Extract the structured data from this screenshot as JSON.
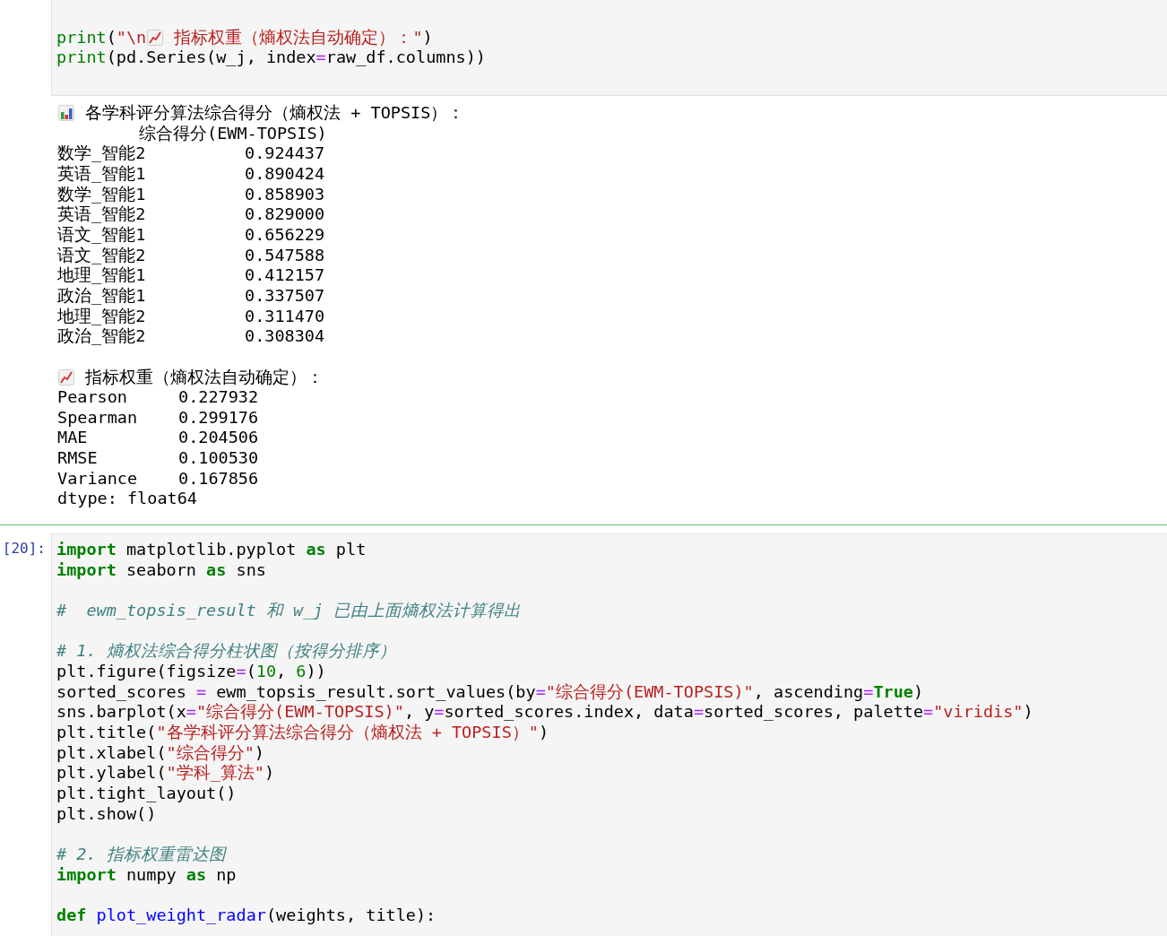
{
  "cells": [
    {
      "kind": "code_tail",
      "lines": [
        {
          "kind": "blank"
        },
        {
          "kind": "code",
          "tokens": [
            {
              "kind": "builtin",
              "text": "print"
            },
            {
              "kind": "txt",
              "text": "("
            },
            {
              "kind": "str",
              "text": "\"\\n"
            },
            {
              "kind": "emoji_line_chart"
            },
            {
              "kind": "str",
              "text": " 指标权重（熵权法自动确定）：\""
            },
            {
              "kind": "txt",
              "text": ")"
            }
          ]
        },
        {
          "kind": "code",
          "tokens": [
            {
              "kind": "builtin",
              "text": "print"
            },
            {
              "kind": "txt",
              "text": "(pd.Series(w_j, index"
            },
            {
              "kind": "op",
              "text": "="
            },
            {
              "kind": "txt",
              "text": "raw_df.columns))"
            }
          ]
        }
      ],
      "output": [
        {
          "kind": "title_bar_chart",
          "text": " 各学科评分算法综合得分（熵权法 + TOPSIS）："
        },
        {
          "kind": "header",
          "text": "综合得分(EWM-TOPSIS)"
        },
        {
          "kind": "row",
          "label": "数学_智能2",
          "value": "0.924437"
        },
        {
          "kind": "row",
          "label": "英语_智能1",
          "value": "0.890424"
        },
        {
          "kind": "row",
          "label": "数学_智能1",
          "value": "0.858903"
        },
        {
          "kind": "row",
          "label": "英语_智能2",
          "value": "0.829000"
        },
        {
          "kind": "row",
          "label": "语文_智能1",
          "value": "0.656229"
        },
        {
          "kind": "row",
          "label": "语文_智能2",
          "value": "0.547588"
        },
        {
          "kind": "row",
          "label": "地理_智能1",
          "value": "0.412157"
        },
        {
          "kind": "row",
          "label": "政治_智能1",
          "value": "0.337507"
        },
        {
          "kind": "row",
          "label": "地理_智能2",
          "value": "0.311470"
        },
        {
          "kind": "row",
          "label": "政治_智能2",
          "value": "0.308304"
        },
        {
          "kind": "blank"
        },
        {
          "kind": "title_line_chart",
          "text": " 指标权重（熵权法自动确定）："
        },
        {
          "kind": "row2",
          "label": "Pearson",
          "value": "0.227932"
        },
        {
          "kind": "row2",
          "label": "Spearman",
          "value": "0.299176"
        },
        {
          "kind": "row2",
          "label": "MAE",
          "value": "0.204506"
        },
        {
          "kind": "row2",
          "label": "RMSE",
          "value": "0.100530"
        },
        {
          "kind": "row2",
          "label": "Variance",
          "value": "0.167856"
        },
        {
          "kind": "text",
          "text": "dtype: float64"
        }
      ]
    },
    {
      "kind": "code_cell",
      "prompt": "[20]:",
      "lines": [
        {
          "kind": "code",
          "tokens": [
            {
              "kind": "kw",
              "text": "import"
            },
            {
              "kind": "txt",
              "text": " matplotlib.pyplot "
            },
            {
              "kind": "kw",
              "text": "as"
            },
            {
              "kind": "txt",
              "text": " plt"
            }
          ]
        },
        {
          "kind": "code",
          "tokens": [
            {
              "kind": "kw",
              "text": "import"
            },
            {
              "kind": "txt",
              "text": " seaborn "
            },
            {
              "kind": "kw",
              "text": "as"
            },
            {
              "kind": "txt",
              "text": " sns"
            }
          ]
        },
        {
          "kind": "blank"
        },
        {
          "kind": "code",
          "tokens": [
            {
              "kind": "com",
              "text": "#  ewm_topsis_result 和 w_j 已由上面熵权法计算得出"
            }
          ]
        },
        {
          "kind": "blank"
        },
        {
          "kind": "code",
          "tokens": [
            {
              "kind": "com",
              "text": "# 1. 熵权法综合得分柱状图（按得分排序）"
            }
          ]
        },
        {
          "kind": "code",
          "tokens": [
            {
              "kind": "txt",
              "text": "plt.figure(figsize"
            },
            {
              "kind": "op",
              "text": "="
            },
            {
              "kind": "txt",
              "text": "("
            },
            {
              "kind": "num",
              "text": "10"
            },
            {
              "kind": "txt",
              "text": ", "
            },
            {
              "kind": "num",
              "text": "6"
            },
            {
              "kind": "txt",
              "text": "))"
            }
          ]
        },
        {
          "kind": "code",
          "tokens": [
            {
              "kind": "txt",
              "text": "sorted_scores "
            },
            {
              "kind": "op",
              "text": "="
            },
            {
              "kind": "txt",
              "text": " ewm_topsis_result.sort_values(by"
            },
            {
              "kind": "op",
              "text": "="
            },
            {
              "kind": "str",
              "text": "\"综合得分(EWM-TOPSIS)\""
            },
            {
              "kind": "txt",
              "text": ", ascending"
            },
            {
              "kind": "op",
              "text": "="
            },
            {
              "kind": "kw",
              "text": "True"
            },
            {
              "kind": "txt",
              "text": ")"
            }
          ]
        },
        {
          "kind": "code",
          "tokens": [
            {
              "kind": "txt",
              "text": "sns.barplot(x"
            },
            {
              "kind": "op",
              "text": "="
            },
            {
              "kind": "str",
              "text": "\"综合得分(EWM-TOPSIS)\""
            },
            {
              "kind": "txt",
              "text": ", y"
            },
            {
              "kind": "op",
              "text": "="
            },
            {
              "kind": "txt",
              "text": "sorted_scores.index, data"
            },
            {
              "kind": "op",
              "text": "="
            },
            {
              "kind": "txt",
              "text": "sorted_scores, palette"
            },
            {
              "kind": "op",
              "text": "="
            },
            {
              "kind": "str",
              "text": "\"viridis\""
            },
            {
              "kind": "txt",
              "text": ")"
            }
          ]
        },
        {
          "kind": "code",
          "tokens": [
            {
              "kind": "txt",
              "text": "plt.title("
            },
            {
              "kind": "str",
              "text": "\"各学科评分算法综合得分（熵权法 + TOPSIS）\""
            },
            {
              "kind": "txt",
              "text": ")"
            }
          ]
        },
        {
          "kind": "code",
          "tokens": [
            {
              "kind": "txt",
              "text": "plt.xlabel("
            },
            {
              "kind": "str",
              "text": "\"综合得分\""
            },
            {
              "kind": "txt",
              "text": ")"
            }
          ]
        },
        {
          "kind": "code",
          "tokens": [
            {
              "kind": "txt",
              "text": "plt.ylabel("
            },
            {
              "kind": "str",
              "text": "\"学科_算法\""
            },
            {
              "kind": "txt",
              "text": ")"
            }
          ]
        },
        {
          "kind": "code",
          "tokens": [
            {
              "kind": "txt",
              "text": "plt.tight_layout()"
            }
          ]
        },
        {
          "kind": "code",
          "tokens": [
            {
              "kind": "txt",
              "text": "plt.show()"
            }
          ]
        },
        {
          "kind": "blank"
        },
        {
          "kind": "code",
          "tokens": [
            {
              "kind": "com",
              "text": "# 2. 指标权重雷达图"
            }
          ]
        },
        {
          "kind": "code",
          "tokens": [
            {
              "kind": "kw",
              "text": "import"
            },
            {
              "kind": "txt",
              "text": " numpy "
            },
            {
              "kind": "kw",
              "text": "as"
            },
            {
              "kind": "txt",
              "text": " np"
            }
          ]
        },
        {
          "kind": "blank"
        },
        {
          "kind": "code",
          "tokens": [
            {
              "kind": "kw",
              "text": "def"
            },
            {
              "kind": "def",
              "text": " plot_weight_radar"
            },
            {
              "kind": "txt",
              "text": "(weights, title):"
            }
          ]
        }
      ]
    }
  ]
}
